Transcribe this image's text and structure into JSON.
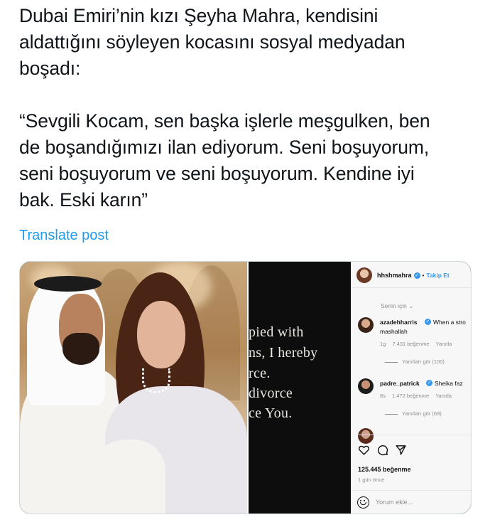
{
  "post": {
    "line1": "Dubai Emiri’nin kızı Şeyha Mahra, kendisini",
    "line2": "aldattığını söyleyen kocasını sosyal medyadan",
    "line3": "boşadı:",
    "quote1": "“Sevgili Kocam, sen başka işlerle meşgulken, ben",
    "quote2": "de boşandığımızı ilan ediyorum. Seni boşuyorum,",
    "quote3": "seni boşuyorum ve seni boşuyorum. Kendine iyi",
    "quote4": "bak. Eski karın”",
    "translate_label": "Translate post"
  },
  "letter": {
    "line1": "pied with",
    "line2": "ns, I hereby",
    "line3": "rce.",
    "line4": "divorce",
    "line5": "ce You."
  },
  "instagram": {
    "username": "hhshmahra",
    "follow_label": "Takip Et",
    "dot": "•",
    "for_you": "Senin için ⌄",
    "comments": [
      {
        "user": "azadehharris",
        "text": "When a stro",
        "text2": "mashallah",
        "time": "1g",
        "likes": "7.431 beğenme",
        "reply": "Yanıtla",
        "replies": "Yanıtları gör (100)"
      },
      {
        "user": "padre_patrick",
        "text": "Sheika faz",
        "time": "8s",
        "likes": "1.472 beğenme",
        "reply": "Yanıtla",
        "replies": "Yanıtları gör (69)"
      }
    ],
    "like_count": "125.445 beğenme",
    "time_ago": "1 gün önce",
    "comment_placeholder": "Yorum ekle..."
  },
  "colors": {
    "link": "#1d9bf0",
    "verified": "#3897f0",
    "text": "#0f1419"
  }
}
